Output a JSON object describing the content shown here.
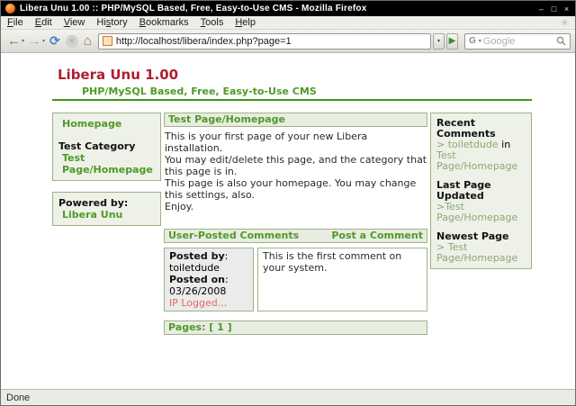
{
  "window": {
    "title": "Libera Unu 1.00 :: PHP/MySQL Based, Free, Easy-to-Use CMS - Mozilla Firefox",
    "controls": {
      "minimize": "–",
      "maximize": "□",
      "close": "×"
    }
  },
  "menubar": {
    "items": [
      {
        "pre": "",
        "accel": "F",
        "post": "ile"
      },
      {
        "pre": "",
        "accel": "E",
        "post": "dit"
      },
      {
        "pre": "",
        "accel": "V",
        "post": "iew"
      },
      {
        "pre": "Hi",
        "accel": "s",
        "post": "tory"
      },
      {
        "pre": "",
        "accel": "B",
        "post": "ookmarks"
      },
      {
        "pre": "",
        "accel": "T",
        "post": "ools"
      },
      {
        "pre": "",
        "accel": "H",
        "post": "elp"
      }
    ]
  },
  "toolbar": {
    "url": "http://localhost/libera/index.php?page=1",
    "search_placeholder": "Google",
    "back_glyph": "←",
    "forward_glyph": "→",
    "reload_glyph": "⟳",
    "stop_glyph": "✕",
    "home_glyph": "⌂",
    "caret_glyph": "▾",
    "go_glyph": "▶",
    "g_glyph": "G"
  },
  "page": {
    "site_title": "Libera Unu 1.00",
    "site_subtitle": "PHP/MySQL Based, Free, Easy-to-Use CMS",
    "left_sidebar": {
      "homepage_link": "Homepage",
      "category_label": "Test Category",
      "category_page_link": "Test Page/Homepage",
      "powered_label": "Powered by:",
      "powered_link": "Libera Unu"
    },
    "main": {
      "page_header": "Test Page/Homepage",
      "body_lines": [
        "This is your first page of your new Libera installation.",
        "You may edit/delete this page, and the category that this page is in.",
        "This page is also your homepage. You may change this settings, also.",
        "Enjoy."
      ],
      "comments_header": "User-Posted Comments",
      "post_comment_link": "Post a Comment",
      "comment": {
        "posted_by_label": "Posted by",
        "posted_by_sep": ": ",
        "posted_by_value": "toiletdude",
        "posted_on_label": "Posted on",
        "posted_on_sep": ": ",
        "posted_on_value": "03/26/2008",
        "ip_logged": "IP Logged...",
        "text": "This is the first comment on your system."
      },
      "pages_label": "Pages: [ 1 ]"
    },
    "right_sidebar": {
      "recent_comments_title": "Recent Comments",
      "recent_comment_user": "> toiletdude",
      "recent_comment_in": " in ",
      "recent_comment_page": "Test Page/Homepage",
      "last_updated_title": "Last Page Updated",
      "last_updated_link": ">Test Page/Homepage",
      "newest_title": "Newest Page",
      "newest_link": "> Test Page/Homepage"
    }
  },
  "statusbar": {
    "text": "Done"
  },
  "colors": {
    "titlebar_bg": "#000000",
    "accent_green": "#4e9a27",
    "rule_green": "#3f9618",
    "heading_red": "#b01e2e",
    "box_border": "#9db388",
    "box_bg": "#eef1e8",
    "ip_logged_red": "#e06868"
  }
}
